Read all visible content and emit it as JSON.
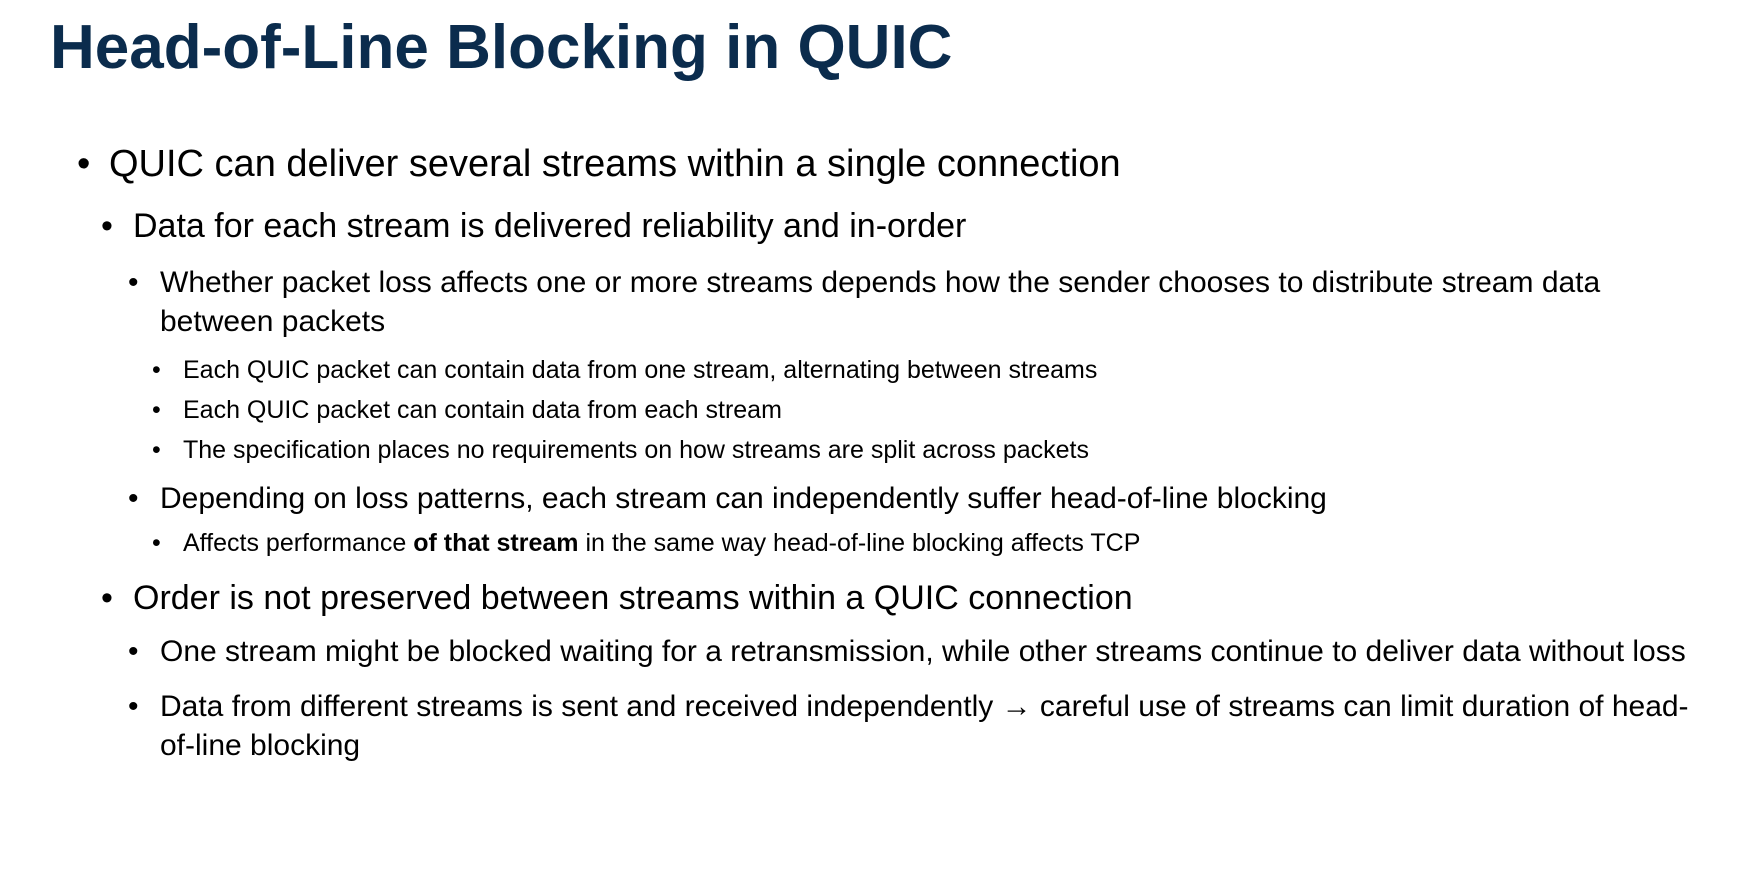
{
  "slide": {
    "title": "Head-of-Line Blocking in QUIC",
    "title_color": "#0b2c4d",
    "text_color": "#000000",
    "background": "#ffffff"
  },
  "bullets": {
    "b1": "QUIC can deliver several streams within a single connection",
    "b2": "Data for each stream is delivered reliability and in-order",
    "b3": "Whether packet loss affects one or more streams depends how the sender chooses to distribute stream data between packets",
    "b4": "Each QUIC packet can contain data from one stream, alternating between streams",
    "b5": "Each QUIC packet can contain data from each stream",
    "b6": "The specification places no requirements on how streams are split across packets",
    "b7": "Depending on loss patterns, each stream can independently suffer head-of-line blocking",
    "b8_pre": "Affects performance ",
    "b8_bold": "of that stream",
    "b8_post": " in the same way head-of-line blocking affects TCP",
    "b9": "Order is not preserved between streams within a QUIC connection",
    "b10": "One stream might be blocked waiting for a retransmission, while other streams continue to deliver data without loss",
    "b11": "Data from different streams is sent and received independently → careful use of streams can limit duration of head-of-line blocking"
  }
}
